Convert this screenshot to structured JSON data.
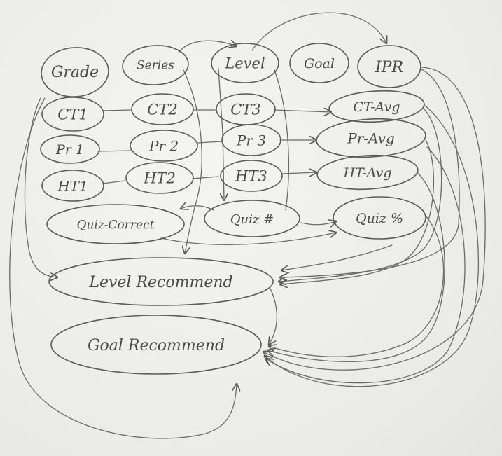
{
  "diagram": {
    "nodes": [
      {
        "id": "grade",
        "label": "Grade"
      },
      {
        "id": "series",
        "label": "Series"
      },
      {
        "id": "level",
        "label": "Level"
      },
      {
        "id": "goal",
        "label": "Goal"
      },
      {
        "id": "ipr",
        "label": "IPR"
      },
      {
        "id": "ct1",
        "label": "CT1"
      },
      {
        "id": "ct2",
        "label": "CT2"
      },
      {
        "id": "ct3",
        "label": "CT3"
      },
      {
        "id": "ctavg",
        "label": "CT-Avg"
      },
      {
        "id": "pr1",
        "label": "Pr 1"
      },
      {
        "id": "pr2",
        "label": "Pr 2"
      },
      {
        "id": "pr3",
        "label": "Pr 3"
      },
      {
        "id": "pravg",
        "label": "Pr-Avg"
      },
      {
        "id": "ht1",
        "label": "HT1"
      },
      {
        "id": "ht2",
        "label": "HT2"
      },
      {
        "id": "ht3",
        "label": "HT3"
      },
      {
        "id": "htavg",
        "label": "HT-Avg"
      },
      {
        "id": "quizcorrect",
        "label": "Quiz-Correct"
      },
      {
        "id": "quiznum",
        "label": "Quiz #"
      },
      {
        "id": "quizpct",
        "label": "Quiz %"
      },
      {
        "id": "levelrec",
        "label": "Level Recommend"
      },
      {
        "id": "goalrec",
        "label": "Goal Recommend"
      }
    ],
    "edges": [
      {
        "from": "series",
        "to": "level"
      },
      {
        "from": "level",
        "to": "ipr"
      },
      {
        "from": "ct1",
        "to": "ct2"
      },
      {
        "from": "ct2",
        "to": "ct3"
      },
      {
        "from": "ct3",
        "to": "ctavg"
      },
      {
        "from": "pr1",
        "to": "pr2"
      },
      {
        "from": "pr2",
        "to": "pr3"
      },
      {
        "from": "pr3",
        "to": "pravg"
      },
      {
        "from": "ht1",
        "to": "ht2"
      },
      {
        "from": "ht2",
        "to": "ht3"
      },
      {
        "from": "ht3",
        "to": "htavg"
      },
      {
        "from": "quiznum",
        "to": "quizcorrect"
      },
      {
        "from": "quiznum",
        "to": "quizpct"
      },
      {
        "from": "quizcorrect",
        "to": "quizpct"
      },
      {
        "from": "level",
        "to": "quiznum"
      },
      {
        "from": "series",
        "to": "levelrec"
      },
      {
        "from": "grade",
        "to": "levelrec"
      },
      {
        "from": "grade",
        "to": "goalrec"
      },
      {
        "from": "ipr",
        "to": "levelrec"
      },
      {
        "from": "ctavg",
        "to": "levelrec"
      },
      {
        "from": "pravg",
        "to": "levelrec"
      },
      {
        "from": "htavg",
        "to": "goalrec"
      },
      {
        "from": "quizpct",
        "to": "goalrec"
      },
      {
        "from": "ipr",
        "to": "goalrec"
      },
      {
        "from": "ctavg",
        "to": "goalrec"
      },
      {
        "from": "pravg",
        "to": "goalrec"
      },
      {
        "from": "levelrec",
        "to": "goalrec"
      }
    ]
  }
}
